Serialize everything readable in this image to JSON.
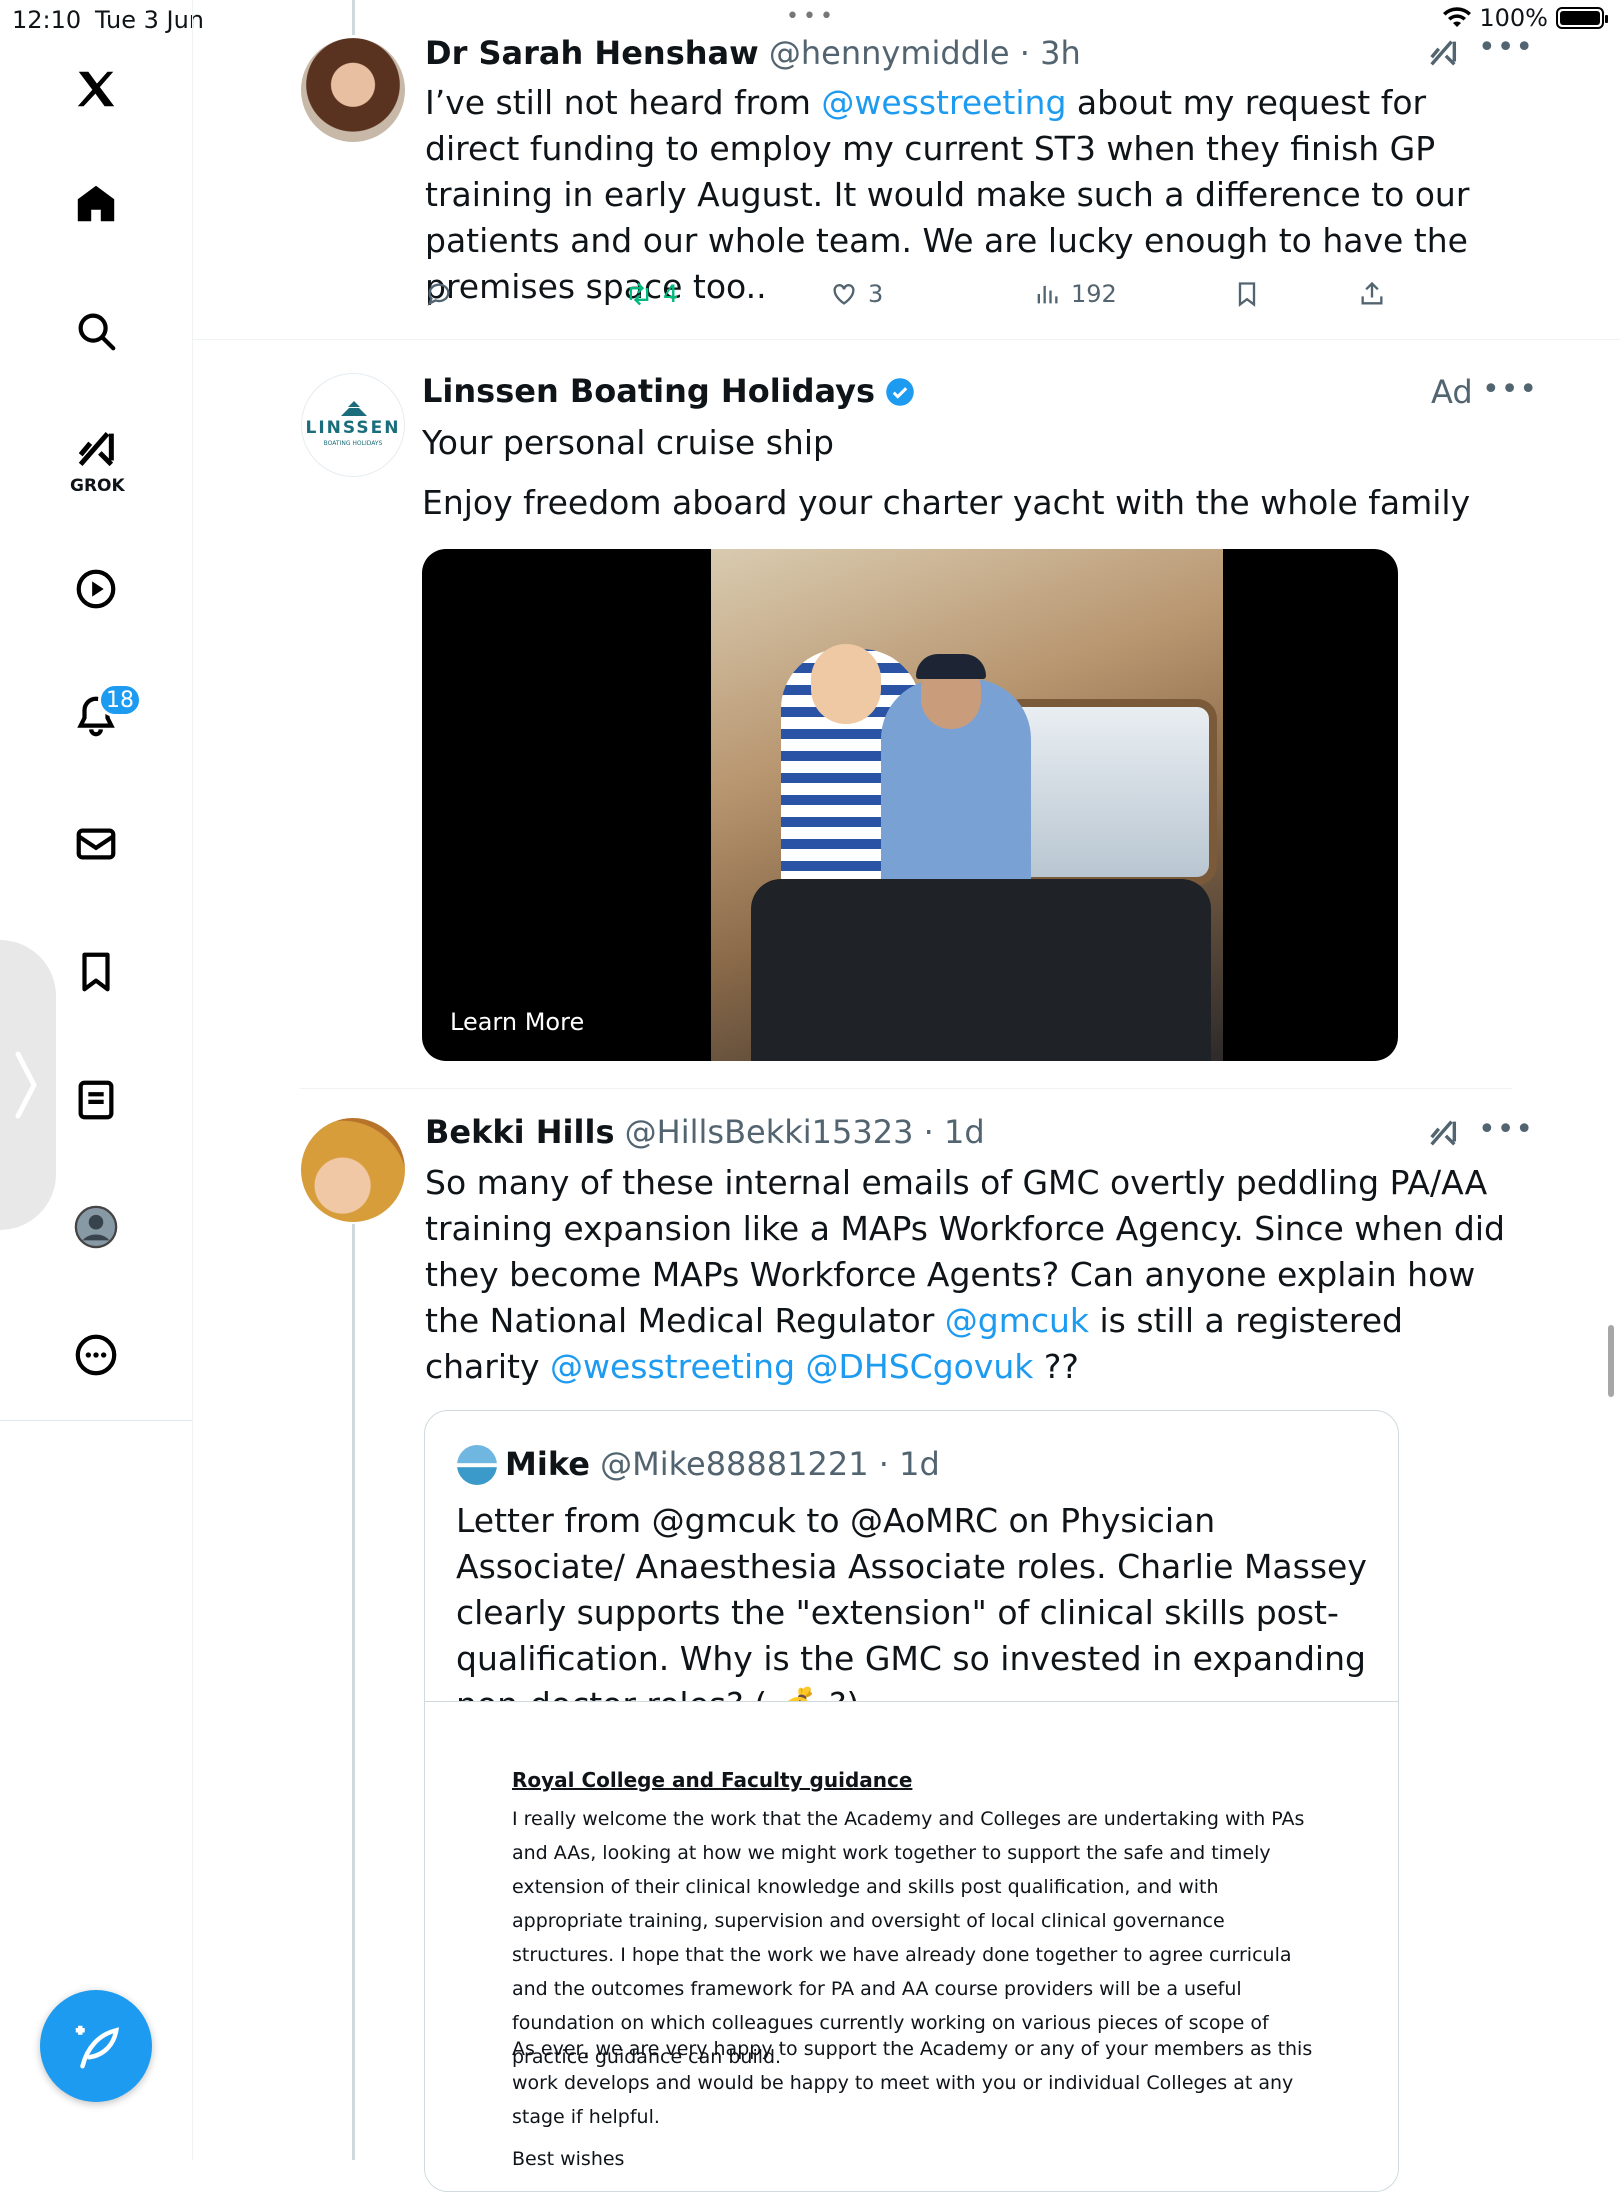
{
  "status_bar": {
    "time": "12:10",
    "date": "Tue 3 Jun",
    "battery": "100%"
  },
  "sidebar": {
    "grok_label": "GROK",
    "notifications_badge": "18",
    "items": [
      "home-icon",
      "search-icon",
      "grok-icon",
      "video-icon",
      "bell-icon",
      "mail-icon",
      "bookmark-icon",
      "lists-icon",
      "profile-icon",
      "more-icon"
    ]
  },
  "tweets": {
    "t1": {
      "name": "Dr Sarah Henshaw",
      "handle": "@hennymiddle",
      "time": "· 3h",
      "text_before": "I’ve still not heard from ",
      "mention": "@wesstreeting",
      "text_after": " about my request for direct funding to employ my current ST3 when they finish GP training in early August. It would make such a difference to our patients and our whole team. We are lucky enough to have the premises space too..",
      "retweets": "4",
      "likes": "3",
      "views": "192"
    },
    "ad": {
      "name": "Linssen Boating Holidays",
      "logo_text": "LINSSEN",
      "logo_sub": "BOATING HOLIDAYS",
      "ad_label": "Ad",
      "headline": "Your personal cruise ship",
      "body": "Enjoy freedom aboard your charter yacht with the whole family",
      "cta": "Learn More"
    },
    "t2": {
      "name": "Bekki Hills",
      "handle": "@HillsBekki15323",
      "time": "· 1d",
      "text_1": "So many of these internal emails of GMC overtly peddling PA/AA training expansion like a MAPs Workforce Agency. Since when did they become MAPs Workforce Agents? Can anyone explain how the National Medical Regulator ",
      "mention_1": "@gmcuk",
      "text_2": " is still a registered charity ",
      "mention_2": "@wesstreeting @DHSCgovuk",
      "text_3": " ??"
    },
    "quote": {
      "name": "Mike",
      "handle": "@Mike88881221",
      "time": "· 1d",
      "text": "Letter from @gmcuk to @AoMRC on Physician Associate/ Anaesthesia Associate roles. Charlie Massey clearly supports the \"extension\" of clinical skills post-qualification. Why is the GMC so invested in expanding non-doctor roles? ( 💰 ?)",
      "doc_heading": "Royal College and Faculty guidance",
      "doc_para1": "I really welcome the work that the Academy and Colleges are undertaking with PAs and AAs, looking at how we might work together to support the safe and timely extension of their clinical knowledge and skills post qualification, and with appropriate training, supervision and oversight of local clinical governance structures. I hope that the work we have already done together to agree curricula and the outcomes framework for PA and AA course providers will be a useful foundation on which colleagues currently working on various pieces of scope of practice guidance can build.",
      "doc_para2": "As ever, we are very happy to support the Academy or any of your members as this work develops and would be happy to meet with you or individual Colleges at any stage if helpful.",
      "doc_signoff": "Best wishes"
    }
  },
  "colors": {
    "accent": "#1d9bf0",
    "secondary_text": "#536471",
    "retweet_green": "#00ba7c"
  }
}
